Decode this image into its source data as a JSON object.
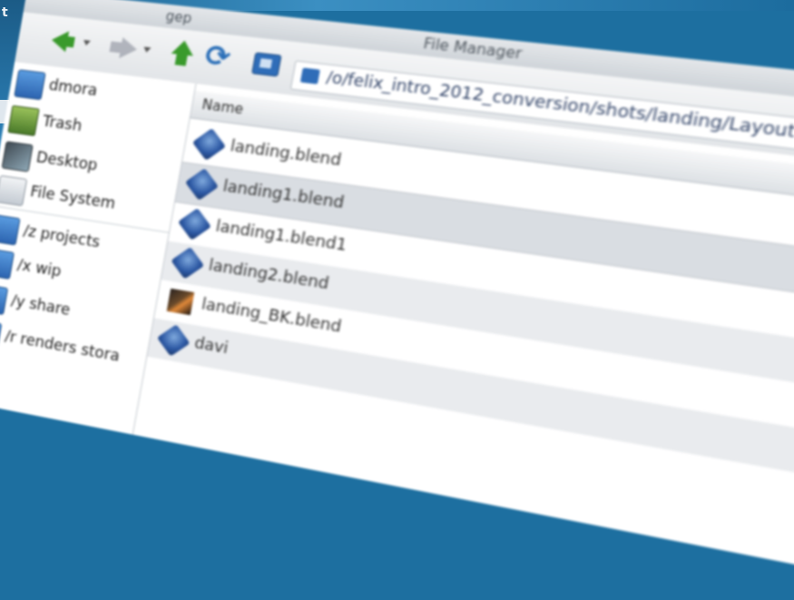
{
  "window": {
    "app_fragment": "gep",
    "title_fragment": "File Manager"
  },
  "desktop": {
    "left_label": "t"
  },
  "toolbar": {
    "back_icon": "arrow-left-icon",
    "forward_icon": "arrow-right-icon",
    "up_icon": "arrow-up-icon",
    "reload_icon": "reload-icon",
    "home_icon": "folder-icon"
  },
  "location": {
    "path": "/o/felix_intro_2012_conversion/shots/landing/Layout"
  },
  "sidebar": {
    "items": [
      {
        "label": "dmora",
        "icon": "user-home-folder-icon"
      },
      {
        "label": "Trash",
        "icon": "trash-icon"
      },
      {
        "label": "Desktop",
        "icon": "desktop-icon"
      },
      {
        "label": "File System",
        "icon": "drive-icon"
      },
      {
        "label": "/z projects",
        "icon": "folder-icon"
      },
      {
        "label": "/x wip",
        "icon": "folder-icon"
      },
      {
        "label": "/y share",
        "icon": "folder-icon"
      },
      {
        "label": "/r renders stora",
        "icon": "folder-icon"
      }
    ]
  },
  "files": {
    "column_name": "Name",
    "rows": [
      {
        "name": "landing.blend",
        "icon": "blend-file-icon"
      },
      {
        "name": "landing1.blend",
        "icon": "blend-file-icon"
      },
      {
        "name": "landing1.blend1",
        "icon": "blend-file-icon"
      },
      {
        "name": "landing2.blend",
        "icon": "blend-file-icon"
      },
      {
        "name": "landing_BK.blend",
        "icon": "image-file-icon"
      },
      {
        "name": "davi",
        "icon": "blend-file-icon"
      }
    ]
  },
  "colors": {
    "desktop": "#1d6fa0",
    "folder": "#2f6db8",
    "nav_arrow": "#3a9a2c"
  }
}
